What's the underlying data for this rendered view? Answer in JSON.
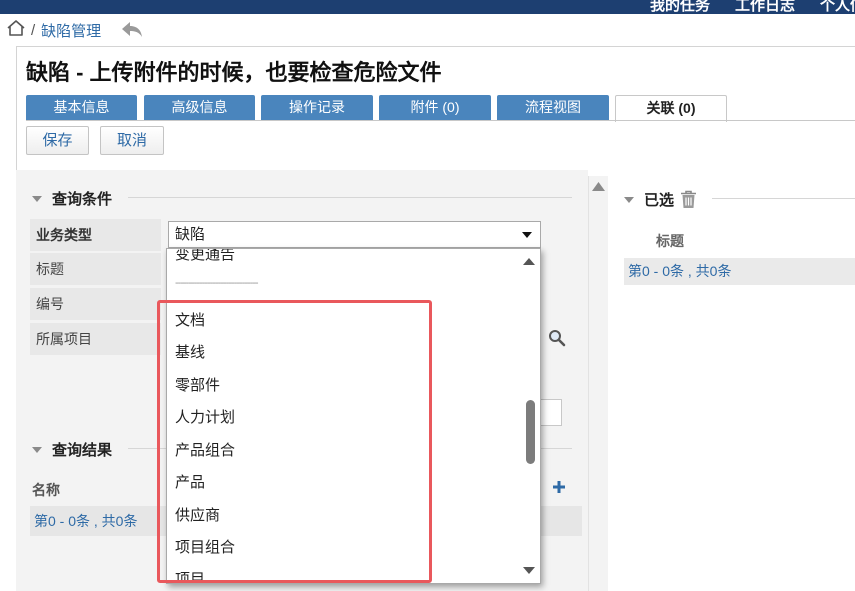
{
  "topbar": {
    "item_1": "我的任务",
    "item_2": "工作日志",
    "item_3": "个人信"
  },
  "breadcrumb": {
    "separator": "/",
    "current": "缺陷管理"
  },
  "page": {
    "title": "缺陷 - 上传附件的时候，也要检查危险文件"
  },
  "tabs": [
    {
      "label": "基本信息"
    },
    {
      "label": "高级信息"
    },
    {
      "label": "操作记录"
    },
    {
      "label": "附件 (0)"
    },
    {
      "label": "流程视图"
    },
    {
      "label": "关联 (0)",
      "active": true
    }
  ],
  "toolbar": {
    "save_label": "保存",
    "cancel_label": "取消"
  },
  "query": {
    "section_title": "查询条件",
    "fields": [
      {
        "label": "业务类型"
      },
      {
        "label": "标题"
      },
      {
        "label": "编号"
      },
      {
        "label": "所属项目"
      }
    ],
    "business_type_value": "缺陷",
    "dropdown_options": [
      "变更通告",
      "-------------------------------",
      "文档",
      "基线",
      "零部件",
      "人力计划",
      "产品组合",
      "产品",
      "供应商",
      "项目组合",
      "项目"
    ]
  },
  "results": {
    "section_title": "查询结果",
    "column_name": "名称",
    "pager_text": "第0 - 0条 , 共0条"
  },
  "selected": {
    "section_title": "已选",
    "column_title": "标题",
    "pager_text": "第0 - 0条 , 共0条"
  },
  "colors": {
    "topbar": "#1d3f71",
    "tab_blue": "#4a85bd",
    "link_blue": "#2e6aa6",
    "highlight_red": "#e9585c",
    "panel_gray": "#f3f3f3"
  },
  "icons": [
    "home-icon",
    "back-arrow-icon",
    "search-icon",
    "trash-icon",
    "plus-icon",
    "collapse-triangle-icon",
    "dropdown-caret-icon"
  ]
}
